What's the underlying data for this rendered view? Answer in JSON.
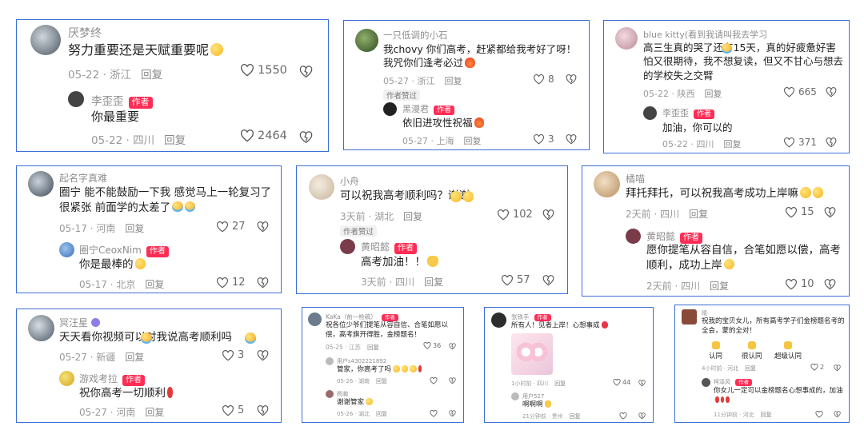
{
  "icons": {
    "like": "heart-outline-icon",
    "dislike": "heart-broken-icon"
  },
  "colors": {
    "border": "#3b6fd6",
    "author_badge": "#ff2d55"
  },
  "cards": [
    {
      "user": "厌梦终",
      "text": "努力重要还是天赋重要呢",
      "time": "05-22 · 浙江",
      "reply": "回复",
      "likes": "1550",
      "sub": {
        "user": "李歪歪",
        "badge": "作者",
        "text": "你最重要",
        "time": "05-22 · 四川",
        "reply": "回复",
        "likes": "2464"
      }
    },
    {
      "user": "一只低调的小石",
      "text": "我chovy 你们高考，赶紧都给我考好了呀！我咒你们逢考必过",
      "time": "05-27 · 浙江",
      "reply": "回复",
      "likes": "8",
      "chip": "作者赞过",
      "sub": {
        "user": "黑漫君",
        "badge": "作者",
        "text": "依旧进攻性祝福",
        "time": "05-27 · 上海",
        "reply": "回复",
        "likes": "3"
      }
    },
    {
      "user": "blue kitty(看到我请叫我去学习",
      "text": "高三生真的哭了还有15天，真的好疲惫好害怕又很期待，我不想复读，但又不甘心与想去的学校失之交臂",
      "time": "05-22 · 陕西",
      "reply": "回复",
      "likes": "665",
      "sub": {
        "user": "李歪歪",
        "badge": "作者",
        "text": "加油，你可以的",
        "time": "05-22 · 四川",
        "reply": "回复",
        "likes": "371"
      }
    },
    {
      "user": "起名字真难",
      "text": "圈宁 能不能鼓励一下我 感觉马上一轮复习了很紧张 前面学的太差了",
      "time": "05-17 · 河南",
      "reply": "回复",
      "likes": "27",
      "sub": {
        "user": "圈宁CeoxNim",
        "badge": "作者",
        "text": "你是最棒的",
        "time": "05-17 · 北京",
        "reply": "回复",
        "likes": "12"
      }
    },
    {
      "user": "小舟",
      "text": "可以祝我高考顺利吗？谢谢",
      "time": "3天前 · 湖北",
      "reply": "回复",
      "likes": "102",
      "chip": "作者赞过",
      "sub": {
        "user": "黄昭懿",
        "badge": "作者",
        "text": "高考加油！！",
        "time": "3天前 · 四川",
        "reply": "回复",
        "likes": "57"
      }
    },
    {
      "user": "橘喵",
      "text": "拜托拜托，可以祝我高考成功上岸嘛",
      "time": "2天前 · 四川",
      "reply": "回复",
      "likes": "15",
      "sub": {
        "user": "黄昭懿",
        "badge": "作者",
        "text": "愿你提笔从容自信，合笔如愿以偿，高考顺利，成功上岸",
        "time": "2天前 · 四川",
        "reply": "回复",
        "likes": "10"
      }
    },
    {
      "user": "冥汪星",
      "text": "天天看你视频可以对我说高考顺利吗",
      "time": "05-27 · 新疆",
      "reply": "回复",
      "likes": "3",
      "sub": {
        "user": "游戏考拉",
        "badge": "作者",
        "text": "祝你高考一切顺利",
        "time": "05-27 · 河南",
        "reply": "回复",
        "likes": "5"
      }
    },
    {
      "user": "KaKa（前一枪稿）",
      "badge": "作者",
      "text": "祝各位少爷们提笔从容自信、合笔如愿以偿，高考旗开得胜，金榜题名！",
      "time": "05-25 · 江苏",
      "reply": "回复",
      "likes": "36",
      "sub1": {
        "user": "用户s4302221892",
        "text": "管家，你高考了吗",
        "time": "05-26 · 湖南",
        "reply": "回复"
      },
      "sub2": {
        "user": "杨瀚",
        "text": "谢谢管家",
        "time": "05-26 · 湖北",
        "reply": "回复"
      }
    },
    {
      "user": "张铁手",
      "badge": "作者",
      "text": "所有人！见者上岸！心想事成",
      "time": "1小时前 · 四川",
      "reply": "回复",
      "likes": "44",
      "sub": {
        "user": "用户527",
        "text": "啊啊啊",
        "time": "21分钟前 · 贵州",
        "reply": "回复"
      }
    },
    {
      "user": "晴",
      "text": "祝我的宝贝女儿，所有高考学子们金榜题名考的全会，蒙的全对！",
      "reactions": [
        "认同",
        "很认同",
        "超级认同"
      ],
      "time": "4小时前 · 河北",
      "reply": "回复",
      "likes": "2",
      "sub": {
        "user": "柯泽风",
        "badge": "作者",
        "text": "你女儿一定可以金榜题名心想事成的，加油",
        "time": "11分钟前 · 河北",
        "reply": "回复"
      }
    }
  ]
}
